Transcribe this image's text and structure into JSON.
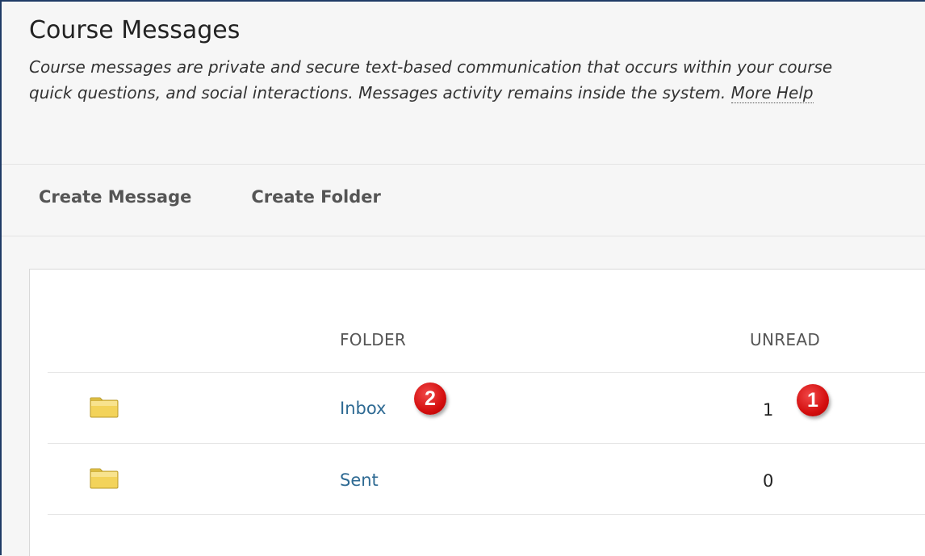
{
  "header": {
    "title": "Course Messages",
    "description_line1": "Course messages are private and secure text-based communication that occurs within your course",
    "description_line2": "quick questions, and social interactions. Messages activity remains inside the system.",
    "more_help": "More Help"
  },
  "toolbar": {
    "create_message": "Create Message",
    "create_folder": "Create Folder"
  },
  "table": {
    "columns": [
      "FOLDER",
      "UNREAD"
    ],
    "rows": [
      {
        "icon": "folder-icon",
        "folder": "Inbox",
        "unread": "1"
      },
      {
        "icon": "folder-icon",
        "folder": "Sent",
        "unread": "0"
      }
    ]
  },
  "annotations": {
    "inbox_marker": "2",
    "unread_marker": "1"
  },
  "colors": {
    "link": "#2e6a93",
    "badge": "#d40f0f",
    "folder": "#f3d35a",
    "frame": "#1f3b66"
  }
}
